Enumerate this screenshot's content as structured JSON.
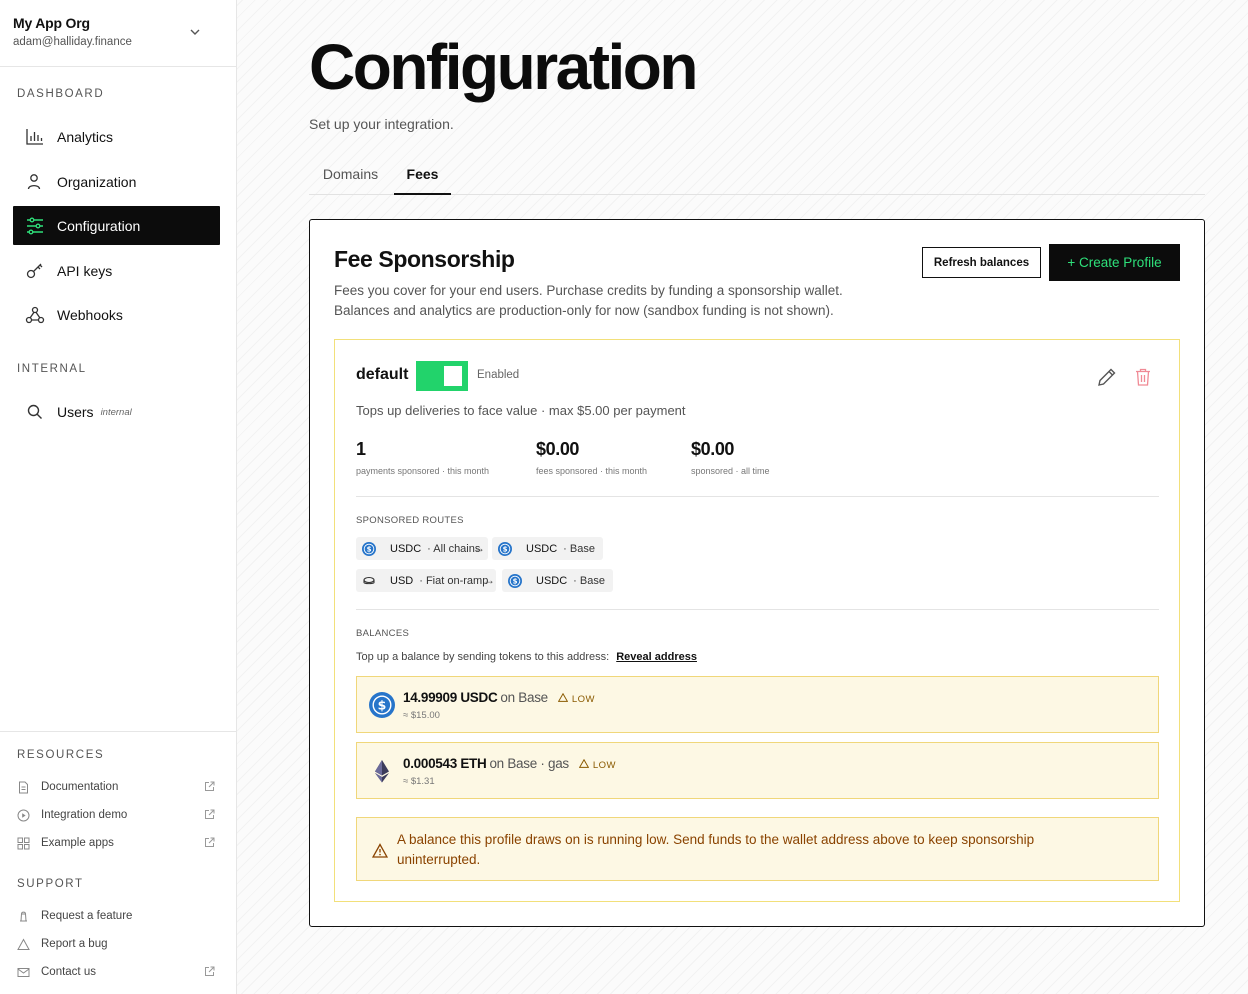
{
  "org": {
    "name": "My App Org",
    "email": "adam@halliday.finance"
  },
  "sidebar": {
    "dashboard_label": "DASHBOARD",
    "items": [
      {
        "label": "Analytics",
        "icon": "bar-chart-icon"
      },
      {
        "label": "Organization",
        "icon": "user-icon"
      },
      {
        "label": "Configuration",
        "icon": "sliders-icon",
        "active": true
      },
      {
        "label": "API keys",
        "icon": "key-icon"
      },
      {
        "label": "Webhooks",
        "icon": "webhook-icon"
      }
    ],
    "internal_label": "INTERNAL",
    "internal_items": [
      {
        "label": "Users",
        "tag": "internal",
        "icon": "search-icon"
      }
    ],
    "resources_label": "RESOURCES",
    "resources": [
      {
        "label": "Documentation",
        "icon": "document-icon"
      },
      {
        "label": "Integration demo",
        "icon": "play-icon"
      },
      {
        "label": "Example apps",
        "icon": "grid-icon"
      }
    ],
    "support_label": "SUPPORT",
    "support": [
      {
        "label": "Request a feature",
        "icon": "lamp-icon"
      },
      {
        "label": "Report a bug",
        "icon": "warning-icon"
      },
      {
        "label": "Contact us",
        "icon": "mail-icon"
      }
    ]
  },
  "page": {
    "title": "Configuration",
    "subtitle": "Set up your integration."
  },
  "tabs": [
    {
      "label": "Domains"
    },
    {
      "label": "Fees",
      "active": true
    }
  ],
  "fee": {
    "title": "Fee Sponsorship",
    "desc_line1": "Fees you cover for your end users. Purchase credits by funding a sponsorship wallet.",
    "desc_line2": "Balances and analytics are production-only for now (sandbox funding is not shown).",
    "refresh_label": "Refresh balances",
    "create_label": "+ Create Profile"
  },
  "profile": {
    "name": "default",
    "enabled": true,
    "enabled_label": "Enabled",
    "description": "Tops up deliveries to face value · max $5.00 per payment",
    "stats": [
      {
        "value": "1",
        "label": "payments sponsored · this month"
      },
      {
        "value": "$0.00",
        "label": "fees sponsored · this month"
      },
      {
        "value": "$0.00",
        "label": "sponsored · all time"
      }
    ],
    "routes_label": "SPONSORED ROUTES",
    "routes": [
      {
        "from_token": "USDC",
        "from_net": "· All chains",
        "arrow": "→",
        "to_token": "USDC",
        "to_net": "· Base"
      },
      {
        "from_token": "USD",
        "from_net": "· Fiat on-ramp",
        "arrow": "→",
        "to_token": "USDC",
        "to_net": "· Base"
      }
    ],
    "balances_label": "BALANCES",
    "topup_text": "Top up a balance by sending tokens to this address:",
    "reveal_label": "Reveal address",
    "balances": [
      {
        "amount": "14.99909 USDC",
        "network": "on Base",
        "status": "LOW",
        "usd": "≈ $15.00",
        "icon": "usdc-icon"
      },
      {
        "amount": "0.000543 ETH",
        "network": "on Base · gas",
        "status": "LOW",
        "usd": "≈ $1.31",
        "icon": "eth-icon"
      }
    ],
    "warning_text": "A balance this profile draws on is running low. Send funds to the wallet address above to keep sponsorship uninterrupted."
  },
  "colors": {
    "accent_green": "#22d36b",
    "warning_bg": "#fdf8e4",
    "warning_border": "#f0d77a",
    "usdc_blue": "#2775ca"
  }
}
